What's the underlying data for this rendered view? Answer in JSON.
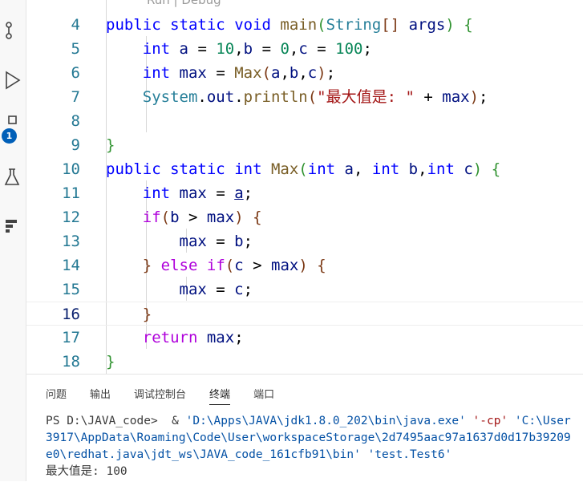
{
  "editor": {
    "codelens": "Run | Debug",
    "lines": [
      {
        "n": "4"
      },
      {
        "n": "5"
      },
      {
        "n": "6"
      },
      {
        "n": "7"
      },
      {
        "n": "8"
      },
      {
        "n": "9"
      },
      {
        "n": "10"
      },
      {
        "n": "11"
      },
      {
        "n": "12"
      },
      {
        "n": "13"
      },
      {
        "n": "14"
      },
      {
        "n": "15"
      },
      {
        "n": "16"
      },
      {
        "n": "17"
      },
      {
        "n": "18"
      }
    ],
    "current_line": "16"
  },
  "activity": {
    "badge": "1",
    "icons": [
      "source-control-icon",
      "run-debug-icon",
      "extensions-icon",
      "testing-icon",
      "java-projects-icon"
    ]
  },
  "panel": {
    "tabs": [
      "问题",
      "输出",
      "调试控制台",
      "终端",
      "端口"
    ],
    "active_tab": "终端",
    "terminal": {
      "l1_prefix": "PS D:\\JAVA_code>  & ",
      "l1_java": "'D:\\Apps\\JAVA\\jdk1.8.0_202\\bin\\java.exe'",
      "l1_cp": " '-cp' ",
      "l1_tail": "'C:\\User",
      "l2": "3917\\AppData\\Roaming\\Code\\User\\workspaceStorage\\2d7495aac97a1637d0d17b39209",
      "l3": "e0\\redhat.java\\jdt_ws\\JAVA_code_161cfb91\\bin' 'test.Test6'",
      "l4": "最大值是: 100"
    }
  }
}
